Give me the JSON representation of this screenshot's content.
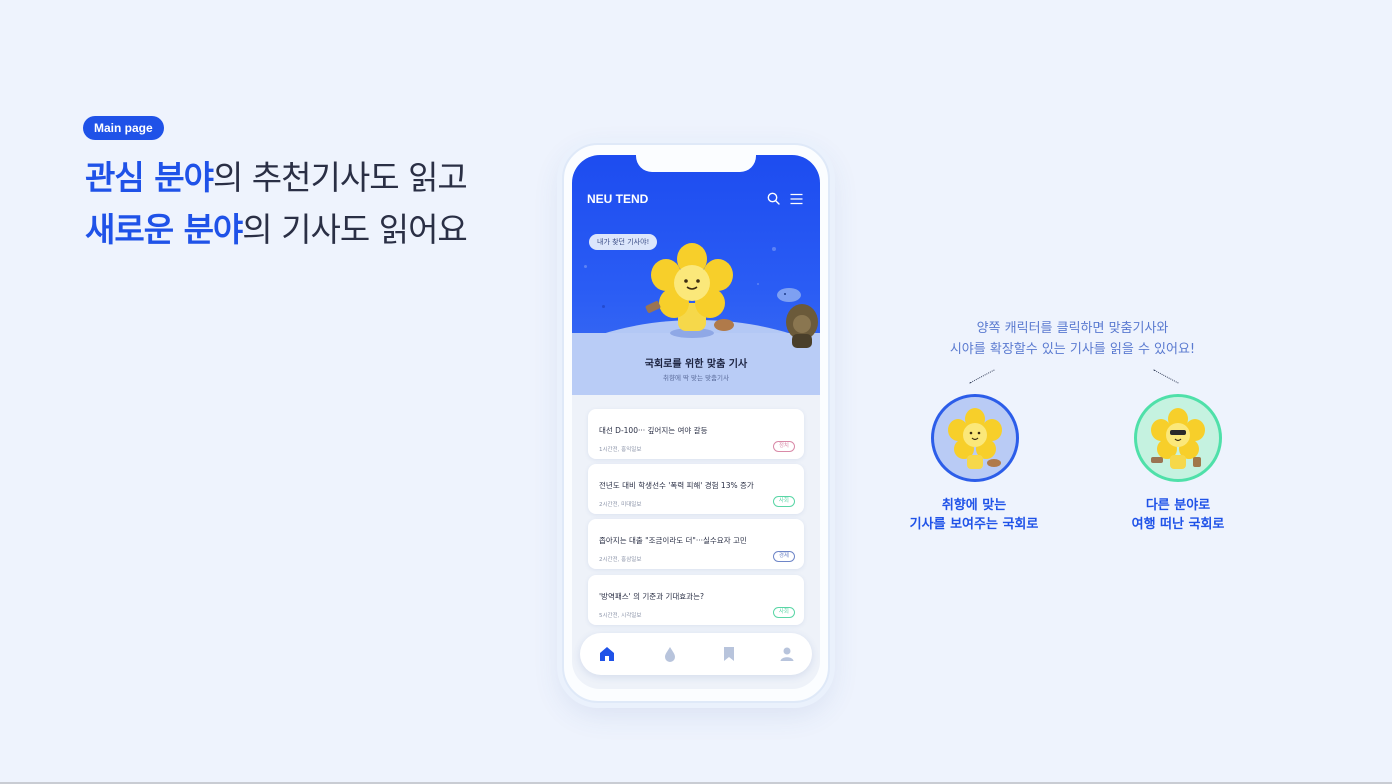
{
  "badge": "Main page",
  "headline": {
    "line1_strong": "관심 분야",
    "line1_rest": "의 추천기사도 읽고",
    "line2_strong": "새로운 분야",
    "line2_rest": "의 기사도 읽어요"
  },
  "app": {
    "logo": "NEU TEND",
    "speech_bubble": "내가 찾던 기사야!",
    "hero_title": "국회로를 위한 맞춤 기사",
    "hero_subtitle": "취향에 딱 맞는 맞춤기사",
    "articles": [
      {
        "title": "대선 D-100··· 깊어지는 여야 갈등",
        "meta": "1시간전, 홍익일보",
        "tag": "정치",
        "tag_color": "#d98aa8"
      },
      {
        "title": "전년도 대비 학생선수 '폭력 피해' 경험 13% 증가",
        "meta": "2시간전, 미대일보",
        "tag": "사회",
        "tag_color": "#5ad6a6"
      },
      {
        "title": "좁아지는 대출 \"조금이라도 더\"···실수요자 고민",
        "meta": "2시간전, 홍삼일보",
        "tag": "경제",
        "tag_color": "#6f86c8"
      },
      {
        "title": "'방역패스' 의 기준과 기대효과는?",
        "meta": "5시간전, 시각일보",
        "tag": "사회",
        "tag_color": "#5ad6a6"
      }
    ],
    "tabs": [
      "home-icon",
      "drop-icon",
      "bookmark-icon",
      "profile-icon"
    ],
    "accent": "#1f52e8"
  },
  "annotation": {
    "line1": "양쪽 캐릭터를 클릭하면 맞춤기사와",
    "line2": "시야를 확장할수 있는 기사를 읽을 수 있어요!",
    "left_caption_1": "취향에 맞는",
    "left_caption_2": "기사를 보여주는 국회로",
    "right_caption_1": "다른 분야로",
    "right_caption_2": "여행 떠난 국회로"
  }
}
